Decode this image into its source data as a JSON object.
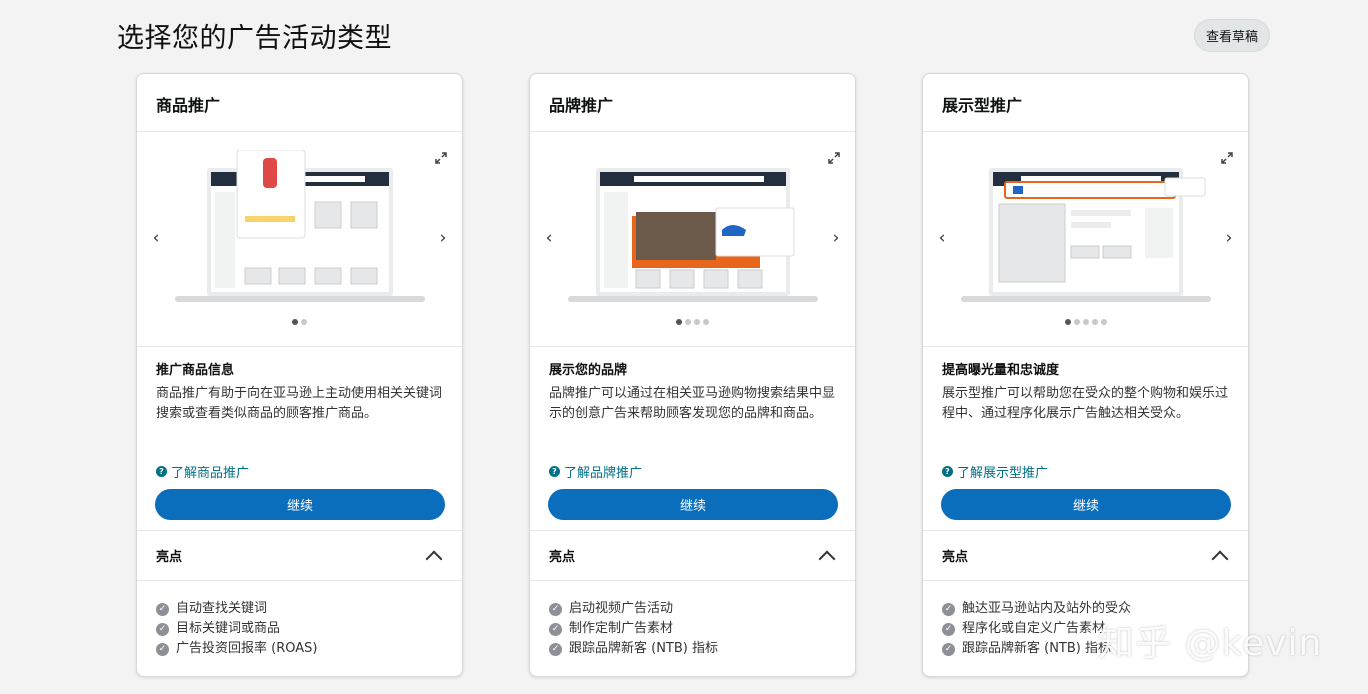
{
  "page": {
    "title": "选择您的广告活动类型",
    "drafts_label": "查看草稿"
  },
  "cards": [
    {
      "header": "商品推广",
      "dots": 2,
      "active_dot": 0,
      "body_title": "推广商品信息",
      "body_desc": "商品推广有助于向在亚马逊上主动使用相关关键词搜索或查看类似商品的顾客推广商品。",
      "learn_label": "了解商品推广",
      "continue_label": "继续",
      "highlights_title": "亮点",
      "highlights": [
        "自动查找关键词",
        "目标关键词或商品",
        "广告投资回报率 (ROAS)"
      ]
    },
    {
      "header": "品牌推广",
      "dots": 4,
      "active_dot": 0,
      "body_title": "展示您的品牌",
      "body_desc": "品牌推广可以通过在相关亚马逊购物搜索结果中显示的创意广告来帮助顾客发现您的品牌和商品。",
      "learn_label": "了解品牌推广",
      "continue_label": "继续",
      "highlights_title": "亮点",
      "highlights": [
        "启动视频广告活动",
        "制作定制广告素材",
        "跟踪品牌新客 (NTB) 指标"
      ]
    },
    {
      "header": "展示型推广",
      "dots": 5,
      "active_dot": 0,
      "body_title": "提高曝光量和忠诚度",
      "body_desc": "展示型推广可以帮助您在受众的整个购物和娱乐过程中、通过程序化展示广告触达相关受众。",
      "learn_label": "了解展示型推广",
      "continue_label": "继续",
      "highlights_title": "亮点",
      "highlights": [
        "触达亚马逊站内及站外的受众",
        "程序化或自定义广告素材",
        "跟踪品牌新客 (NTB) 指标"
      ]
    }
  ],
  "icons": {
    "expand": "expand-icon",
    "prev": "chevron-left-icon",
    "next": "chevron-right-icon",
    "help": "question-circle-icon",
    "collapse": "chevron-up-icon",
    "check": "check-circle-icon"
  },
  "colors": {
    "primary_button": "#0a6ebd",
    "link": "#007185",
    "background": "#f3f3f3"
  },
  "watermark": "知乎 @kevin"
}
